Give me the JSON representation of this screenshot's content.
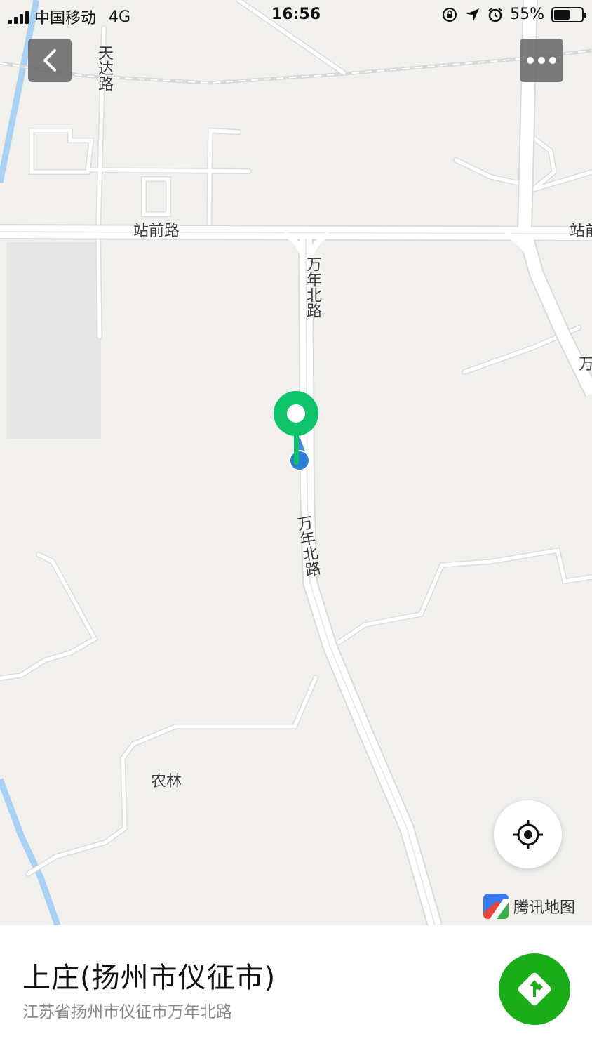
{
  "status": {
    "carrier": "中国移动",
    "network": "4G",
    "time": "16:56",
    "battery_percent": "55%"
  },
  "map": {
    "labels": {
      "tianda_road": "天达路",
      "zhanqian_road": "站前路",
      "zhanqian_road_right": "站前",
      "wannian_north_upper": "万年北路",
      "wannian_north_lower": "万年北路",
      "wan_right": "万",
      "nonglin": "农林"
    },
    "brand": "腾讯地图",
    "colors": {
      "land": "#f1f0ed",
      "road": "#ffffff",
      "water": "#a9d1f3",
      "pin": "#0fc36b",
      "location_dot": "#2c7fd6"
    }
  },
  "place": {
    "name": "上庄(扬州市仪征市)",
    "address": "江苏省扬州市仪征市万年北路"
  },
  "icons": [
    "back-arrow-icon",
    "more-dots-icon",
    "locate-icon",
    "tencent-map-logo-icon",
    "navigation-arrow-icon",
    "location-pin-icon"
  ]
}
